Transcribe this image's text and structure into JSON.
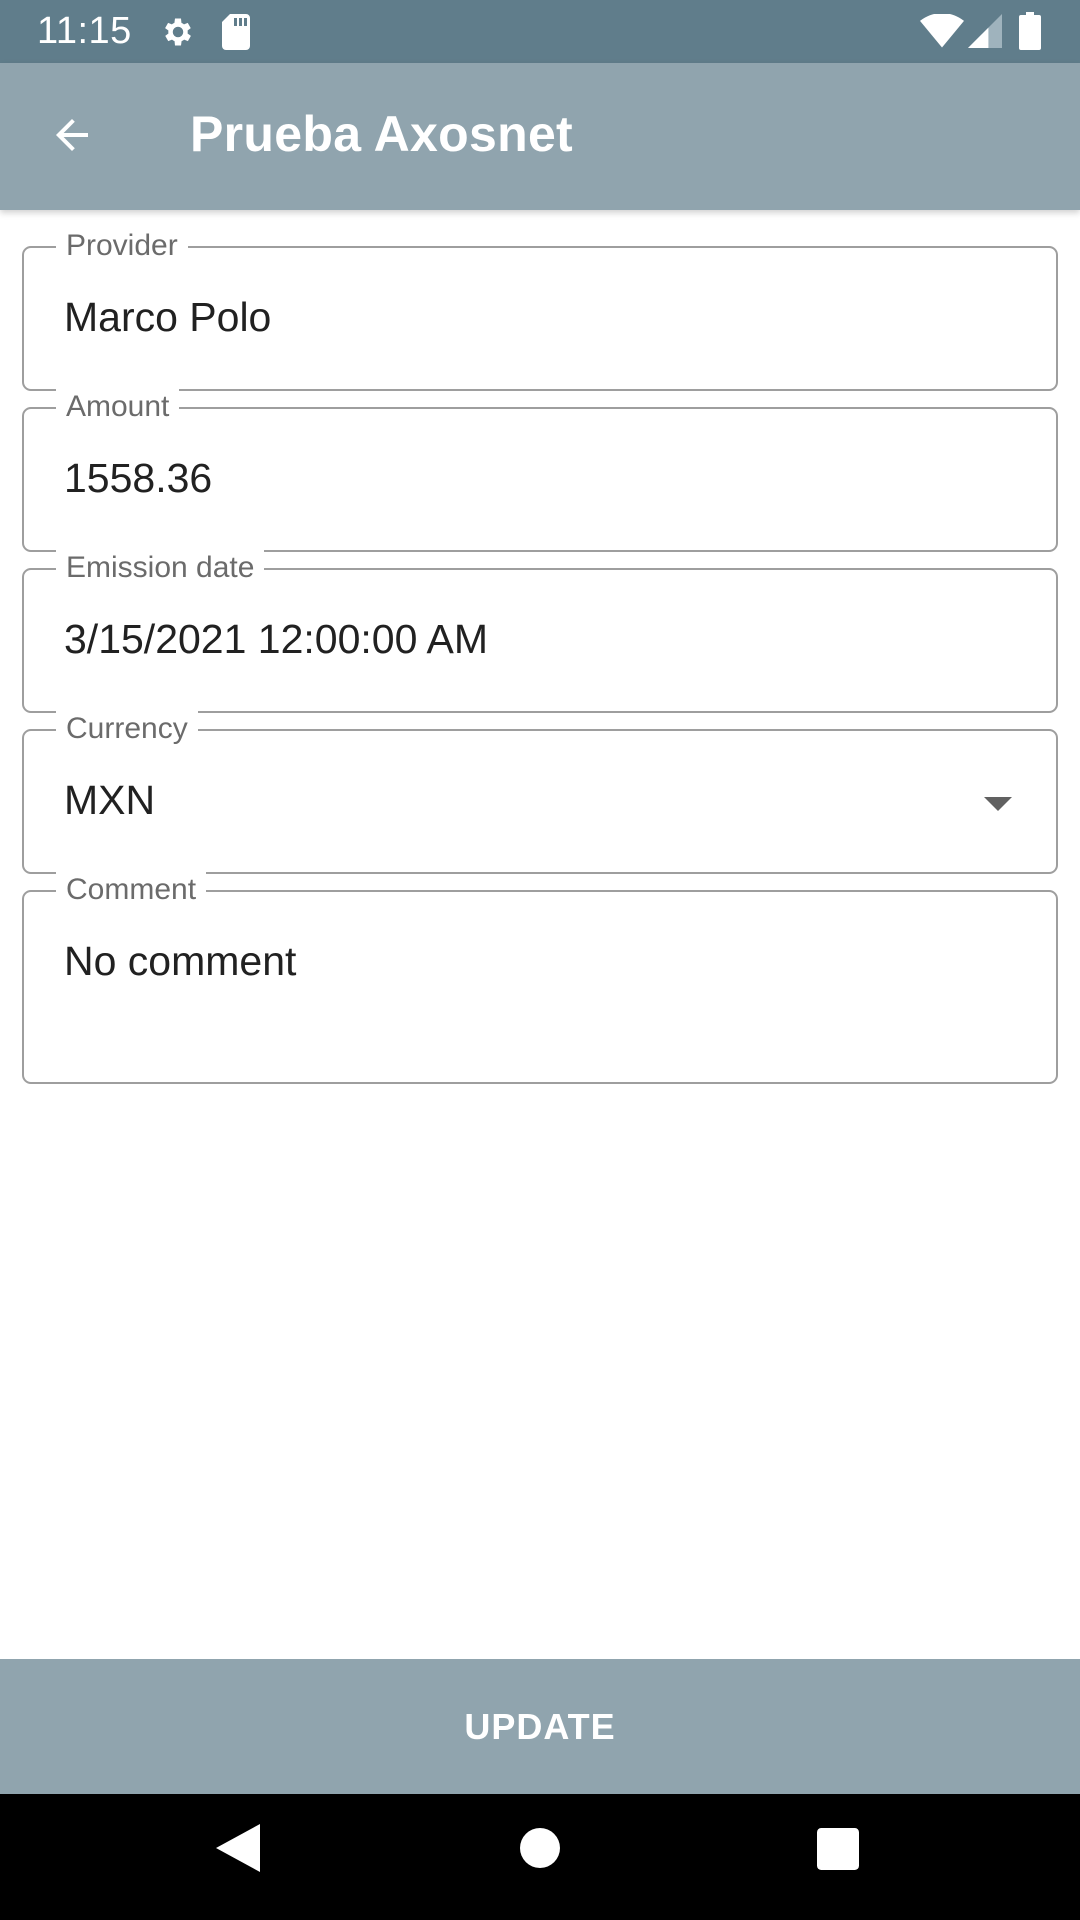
{
  "status_bar": {
    "time": "11:15",
    "icons": [
      "gear-icon",
      "sd-card-icon",
      "wifi-icon",
      "signal-icon",
      "battery-icon"
    ]
  },
  "app_bar": {
    "back_icon": "arrow-left-icon",
    "title": "Prueba Axosnet"
  },
  "form": {
    "provider": {
      "label": "Provider",
      "value": "Marco Polo"
    },
    "amount": {
      "label": "Amount",
      "value": "1558.36"
    },
    "emission_date": {
      "label": "Emission date",
      "value": "3/15/2021 12:00:00 AM"
    },
    "currency": {
      "label": "Currency",
      "value": "MXN",
      "icon": "dropdown-arrow-icon"
    },
    "comment": {
      "label": "Comment",
      "value": "No comment"
    }
  },
  "update_button": {
    "label": "UPDATE"
  },
  "nav_bar": {
    "icons": [
      "back-triangle-icon",
      "home-circle-icon",
      "recents-square-icon"
    ]
  },
  "colors": {
    "status_bar": "#607d8b",
    "app_bar": "#90a4ae",
    "field_border": "#9e9e9e",
    "label_text": "#6b6b6b",
    "value_text": "#212121",
    "nav_bar": "#000000"
  }
}
